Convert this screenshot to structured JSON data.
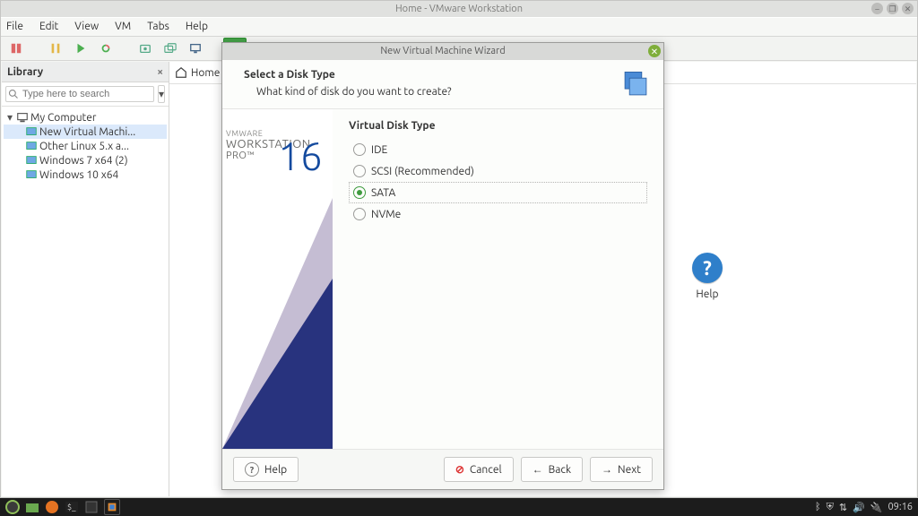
{
  "window": {
    "title": "Home - VMware Workstation"
  },
  "menubar": [
    "File",
    "Edit",
    "View",
    "VM",
    "Tabs",
    "Help"
  ],
  "library": {
    "title": "Library",
    "search_placeholder": "Type here to search",
    "root": "My Computer",
    "items": [
      "New Virtual Machi...",
      "Other Linux 5.x a...",
      "Windows 7 x64 (2)",
      "Windows 10 x64"
    ]
  },
  "tabs": {
    "home": "Home"
  },
  "help_tile": {
    "label": "Help"
  },
  "logo": {
    "vm": "vm",
    "ware": "ware"
  },
  "dialog": {
    "title": "New Virtual Machine Wizard",
    "heading": "Select a Disk Type",
    "subheading": "What kind of disk do you want to create?",
    "section": "Virtual Disk Type",
    "options": [
      "IDE",
      "SCSI (Recommended)",
      "SATA",
      "NVMe"
    ],
    "selected_index": 2,
    "brand_small": "VMWARE",
    "brand_big": "WORKSTATION",
    "brand_pro": "PRO™",
    "brand_ver": "16",
    "buttons": {
      "help": "Help",
      "cancel": "Cancel",
      "back": "Back",
      "next": "Next"
    }
  },
  "taskbar": {
    "time": "09:16"
  }
}
